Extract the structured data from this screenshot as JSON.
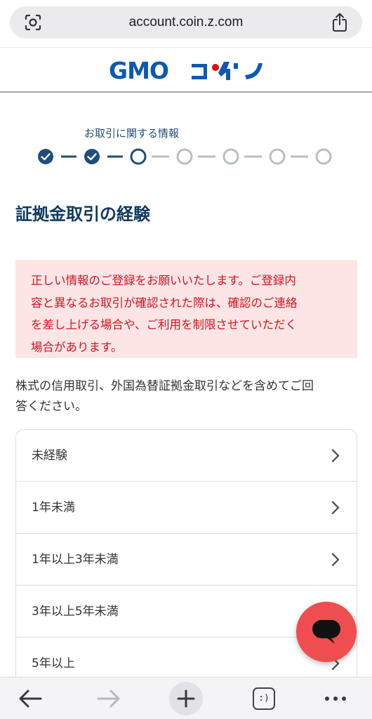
{
  "browser": {
    "url": "account.coin.z.com"
  },
  "header": {
    "logo_text": "GMOコイン"
  },
  "stepper": {
    "label": "お取引に関する情報",
    "total_steps": 7,
    "completed_steps": 2,
    "current_step": 3
  },
  "page": {
    "title": "証拠金取引の経験",
    "alert": "正しい情報のご登録をお願いいたします。ご登録内容と異なるお取引が確認された際は、確認のご連絡を差し上げる場合や、ご利用を制限させていただく場合があります。",
    "alert_lines": [
      "正しい情報のご登録をお願いいたします。ご登録内",
      "容と異なるお取引が確認された際は、確認のご連絡",
      "を差し上げる場合や、ご利用を制限させていただく",
      "場合があります。"
    ],
    "description_lines": [
      "株式の信用取引、外国為替証拠金取引などを含めてご回",
      "答ください。"
    ],
    "options": [
      "未経験",
      "1年未満",
      "1年以上3年未満",
      "3年以上5年未満",
      "5年以上"
    ]
  },
  "colors": {
    "brand_blue": "#1f4e79",
    "logo_blue": "#0a5ab4",
    "logo_red": "#e50012",
    "alert_bg": "#fde5e6",
    "alert_text": "#d4151f",
    "chat_button": "#ef4d4f"
  },
  "toolbar": {
    "tabs_label": ":)"
  }
}
